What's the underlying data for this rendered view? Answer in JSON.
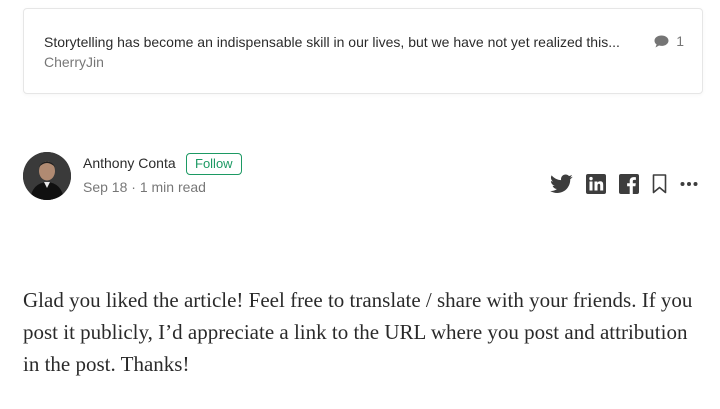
{
  "parent_response": {
    "snippet": "Storytelling has become an indispensable skill in our lives, but we have not yet realized this...",
    "author": "CherryJin",
    "response_count": "1",
    "count_icon": "speech-bubble-icon"
  },
  "post": {
    "author_name": "Anthony Conta",
    "follow_label": "Follow",
    "date": "Sep 18",
    "separator": "·",
    "read_time": "1 min read",
    "body": "Glad you liked the article! Feel free to translate / share with your friends. If you post it publicly, I’d appreciate a link to the URL where you post and attribution in the post. Thanks!"
  },
  "share_icons": [
    "twitter-icon",
    "linkedin-icon",
    "facebook-icon",
    "bookmark-icon",
    "more-icon"
  ],
  "colors": {
    "accent_green": "#1c9963",
    "text_primary": "rgba(0,0,0,0.84)",
    "text_secondary": "rgba(0,0,0,0.54)",
    "card_border": "#e6e6e6"
  }
}
